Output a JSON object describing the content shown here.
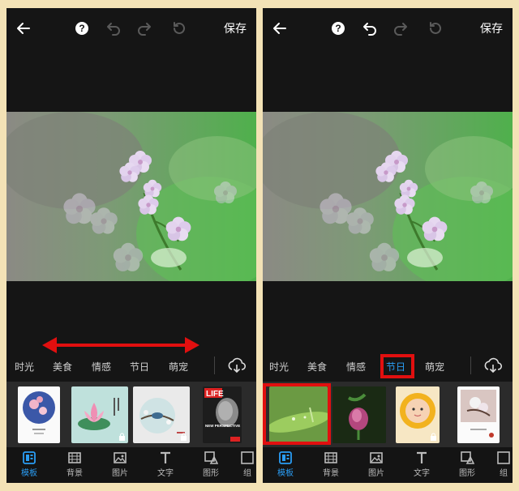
{
  "left_screen": {
    "toolbar": {
      "save_label": "保存",
      "help_glyph": "?",
      "icons": [
        "back-arrow-icon",
        "help-icon",
        "undo-icon",
        "redo-icon",
        "reset-icon"
      ]
    },
    "categories": [
      {
        "label": "时光",
        "active": false
      },
      {
        "label": "美食",
        "active": false
      },
      {
        "label": "情感",
        "active": false
      },
      {
        "label": "节日",
        "active": false
      },
      {
        "label": "萌宠",
        "active": false
      }
    ],
    "templates": [
      {
        "name": "plum-blossom-circle-template",
        "caption": "",
        "locked": false
      },
      {
        "name": "lotus-template",
        "caption": "",
        "locked": true
      },
      {
        "name": "bird-branch-template",
        "caption": "",
        "locked": true
      },
      {
        "name": "life-magazine-template",
        "caption": "LIFE",
        "subcaption": "NEW PERSPECTIVE",
        "locked": false
      }
    ],
    "nav": [
      {
        "label": "模板",
        "icon": "template-icon",
        "active": true
      },
      {
        "label": "背景",
        "icon": "background-icon",
        "active": false
      },
      {
        "label": "图片",
        "icon": "image-icon",
        "active": false
      },
      {
        "label": "文字",
        "icon": "text-icon",
        "active": false
      },
      {
        "label": "图形",
        "icon": "shape-icon",
        "active": false
      },
      {
        "label": "组",
        "icon": "group-icon",
        "active": false
      }
    ]
  },
  "right_screen": {
    "toolbar": {
      "save_label": "保存",
      "help_glyph": "?",
      "icons": [
        "back-arrow-icon",
        "help-icon",
        "undo-icon",
        "redo-icon",
        "reset-icon"
      ]
    },
    "categories": [
      {
        "label": "时光",
        "active": false
      },
      {
        "label": "美食",
        "active": false
      },
      {
        "label": "情感",
        "active": false
      },
      {
        "label": "节日",
        "active": true
      },
      {
        "label": "萌宠",
        "active": false
      }
    ],
    "templates": [
      {
        "name": "green-leaf-template",
        "locked": false,
        "highlighted": true
      },
      {
        "name": "purple-bud-template",
        "locked": false
      },
      {
        "name": "baby-sunflower-template",
        "locked": true
      },
      {
        "name": "blossom-card-template",
        "locked": false
      }
    ],
    "nav": [
      {
        "label": "模板",
        "icon": "template-icon",
        "active": true
      },
      {
        "label": "背景",
        "icon": "background-icon",
        "active": false
      },
      {
        "label": "图片",
        "icon": "image-icon",
        "active": false
      },
      {
        "label": "文字",
        "icon": "text-icon",
        "active": false
      },
      {
        "label": "图形",
        "icon": "shape-icon",
        "active": false
      },
      {
        "label": "组",
        "icon": "group-icon",
        "active": false
      }
    ]
  },
  "colors": {
    "accent": "#2a9df4",
    "annotation_red": "#e10f0f",
    "app_background": "#151515",
    "page_background": "#f3e2b6"
  }
}
